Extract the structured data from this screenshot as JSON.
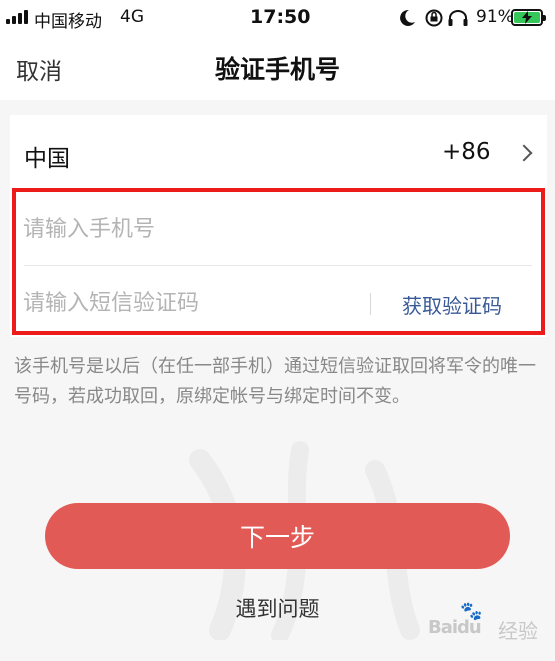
{
  "status_bar": {
    "carrier": "中国移动",
    "network": "4G",
    "time": "17:50",
    "battery_percent": "91%",
    "icons": [
      "moon-icon",
      "rotation-lock-icon",
      "headphones-icon",
      "battery-charging-icon"
    ]
  },
  "nav": {
    "cancel_label": "取消",
    "title": "验证手机号"
  },
  "form": {
    "country_name": "中国",
    "country_code": "+86",
    "phone_placeholder": "请输入手机号",
    "phone_value": "",
    "code_placeholder": "请输入短信验证码",
    "code_value": "",
    "get_code_label": "获取验证码"
  },
  "note": "该手机号是以后（在任一部手机）通过短信验证取回将军令的唯一号码，若成功取回，原绑定帐号与绑定时间不变。",
  "actions": {
    "next_label": "下一步",
    "help_label": "遇到问题"
  },
  "watermark": {
    "brand": "Baidu",
    "brand_cn": "经验"
  },
  "colors": {
    "accent": "#e25a55",
    "highlight_border": "#ee1b1b",
    "link": "#3a5a97",
    "battery": "#35c759"
  }
}
